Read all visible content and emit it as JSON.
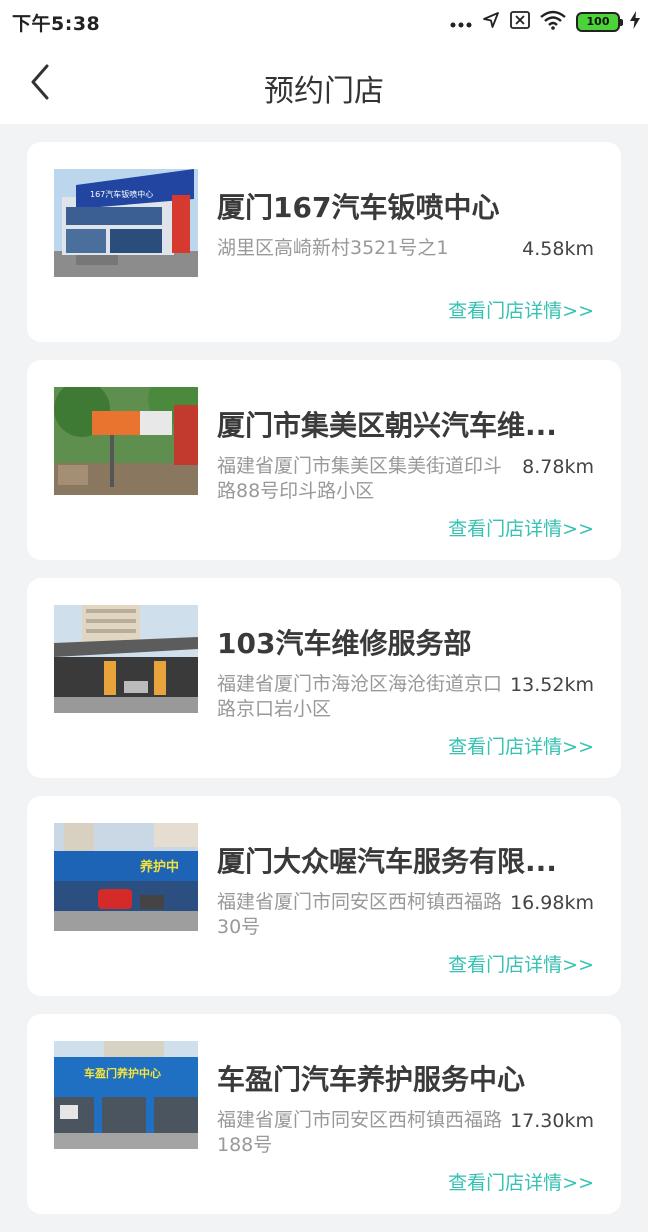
{
  "status_bar": {
    "time": "下午5:38",
    "battery": "100",
    "icons": [
      "dots-icon",
      "location-arrow-icon",
      "sim-x-icon",
      "wifi-icon",
      "battery-icon",
      "charging-bolt-icon"
    ]
  },
  "nav": {
    "title": "预约门店",
    "back_icon": "chevron-left-icon"
  },
  "colors": {
    "accent": "#35c2b3",
    "background": "#f2f3f5",
    "card": "#ffffff",
    "battery": "#4cd33a"
  },
  "stores": [
    {
      "name": "厦门167汽车钣喷中心",
      "address": "湖里区高崎新村3521号之1",
      "distance": "4.58km",
      "detail_link": "查看门店详情>>",
      "sign_text": "167汽车钣喷中心"
    },
    {
      "name": "厦门市集美区朝兴汽车维...",
      "address": "福建省厦门市集美区集美街道印斗路88号印斗路小区",
      "distance": "8.78km",
      "detail_link": "查看门店详情>>"
    },
    {
      "name": "103汽车维修服务部",
      "address": "福建省厦门市海沧区海沧街道京口路京口岩小区",
      "distance": "13.52km",
      "detail_link": "查看门店详情>>"
    },
    {
      "name": "厦门大众喔汽车服务有限...",
      "address": "福建省厦门市同安区西柯镇西福路30号",
      "distance": "16.98km",
      "detail_link": "查看门店详情>>",
      "sign_text": "养护中"
    },
    {
      "name": "车盈门汽车养护服务中心",
      "address": "福建省厦门市同安区西柯镇西福路188号",
      "distance": "17.30km",
      "detail_link": "查看门店详情>>",
      "sign_text": "车盈门养护中心"
    }
  ]
}
